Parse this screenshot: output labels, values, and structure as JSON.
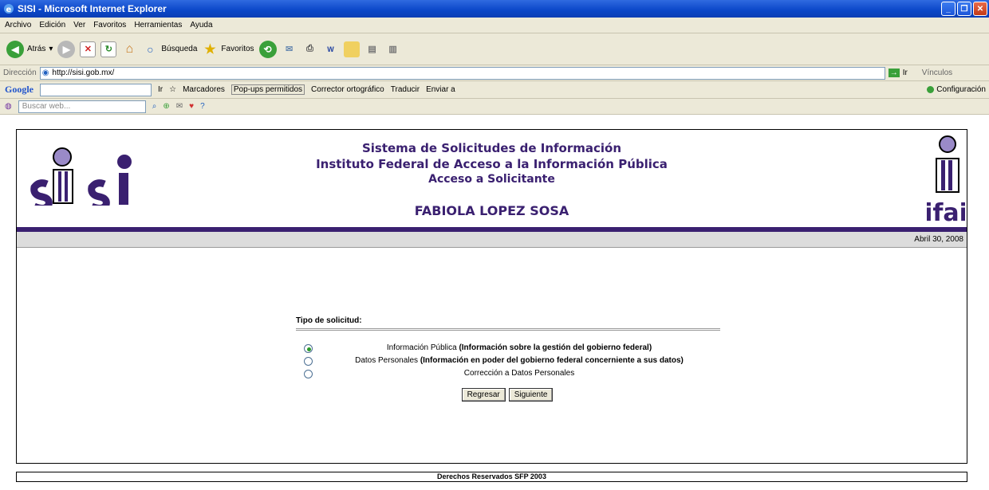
{
  "window": {
    "title": "SISI - Microsoft Internet Explorer"
  },
  "menu": [
    "Archivo",
    "Edición",
    "Ver",
    "Favoritos",
    "Herramientas",
    "Ayuda"
  ],
  "toolbar": {
    "back": "Atrás",
    "search": "Búsqueda",
    "favorites": "Favoritos"
  },
  "address": {
    "label": "Dirección",
    "url": "http://sisi.gob.mx/",
    "go": "Ir",
    "links": "Vínculos"
  },
  "google_bar": {
    "go": "Ir",
    "bookmarks": "Marcadores",
    "popups": "Pop-ups permitidos",
    "spell": "Corrector ortográfico",
    "translate": "Traducir",
    "send": "Enviar a",
    "config": "Configuración"
  },
  "yahoo_bar": {
    "placeholder": "Buscar web..."
  },
  "header": {
    "line1": "Sistema de Solicitudes de Información",
    "line2": "Instituto Federal de Acceso a la Información Pública",
    "line3": "Acceso a Solicitante",
    "user": "FABIOLA LOPEZ SOSA",
    "logo_left": "sisi",
    "logo_right": "ifai",
    "date": "Abril 30, 2008"
  },
  "form": {
    "title": "Tipo de solicitud:",
    "options": [
      {
        "plain": "Información Pública ",
        "bold": "(Información sobre la gestión del gobierno federal)",
        "checked": true
      },
      {
        "plain": "Datos Personales ",
        "bold": "(Información en poder del gobierno federal concerniente a sus datos)",
        "checked": false
      },
      {
        "plain": "Corrección a Datos Personales",
        "bold": "",
        "checked": false
      }
    ],
    "back_button": "Regresar",
    "next_button": "Siguiente"
  },
  "footer": "Derechos Reservados SFP 2003",
  "colors": {
    "brand_purple": "#3a2070",
    "xp_blue": "#0a46c8"
  }
}
